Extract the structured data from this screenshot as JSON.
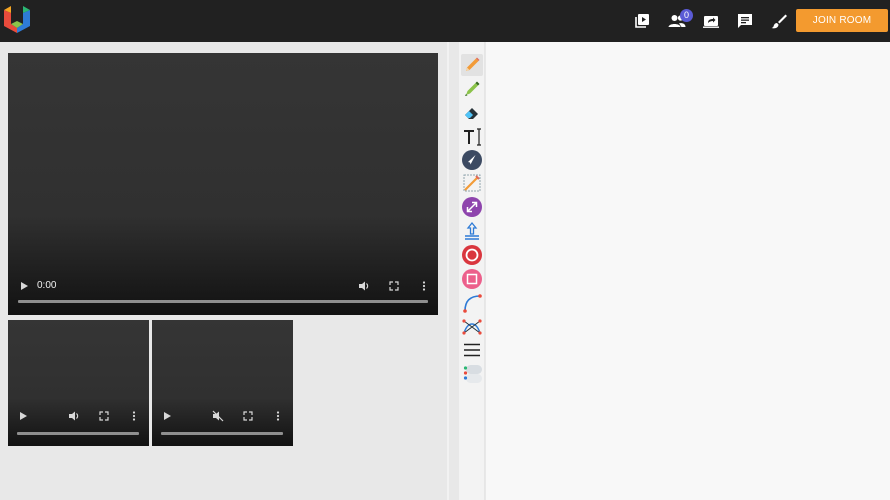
{
  "header": {
    "join_label": "JOIN ROOM",
    "participants_count": "0",
    "icons": [
      "app-logo",
      "playlist-play-icon",
      "people-icon",
      "screen-share-icon",
      "chat-icon",
      "brush-icon"
    ],
    "colors": {
      "topbar": "#212121",
      "join_button": "#f39a2f",
      "badge": "#5b5bd6"
    }
  },
  "videos": {
    "main": {
      "time": "0:00"
    }
  },
  "whiteboard": {
    "tools": [
      "pencil",
      "highlighter",
      "eraser",
      "text",
      "pointer",
      "line",
      "arrow",
      "upload",
      "circle",
      "rectangle",
      "curve",
      "bezier",
      "line-width",
      "color-palette"
    ]
  }
}
